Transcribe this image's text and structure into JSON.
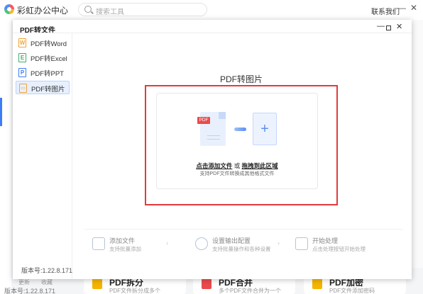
{
  "app": {
    "name": "彩虹办公中心",
    "search_placeholder": "搜索工具",
    "contact": "联系我们",
    "minimize": "—",
    "close": "✕",
    "version": "版本号:1.22.8.171",
    "update": "更新",
    "collect": "收藏"
  },
  "bg_cards": [
    {
      "title": "PDF拆分",
      "sub": "PDF文件拆分成多个"
    },
    {
      "title": "PDF合并",
      "sub": "多个PDF文件合并为一个"
    },
    {
      "title": "PDF加密",
      "sub": "PDF文件添加密码"
    }
  ],
  "dialog": {
    "title": "PDF转文件",
    "minimize": "—",
    "close": "✕",
    "version": "版本号:1.22.8.171",
    "nav": [
      {
        "label": "PDF转Word",
        "icon": "word-icon",
        "glyph": "W",
        "color": "#f0a43a"
      },
      {
        "label": "PDF转Excel",
        "icon": "excel-icon",
        "glyph": "E",
        "color": "#3fae6a"
      },
      {
        "label": "PDF转PPT",
        "icon": "ppt-icon",
        "glyph": "P",
        "color": "#3d7cf5"
      },
      {
        "label": "PDF转图片",
        "icon": "image-icon",
        "glyph": "▭",
        "color": "#f0a43a"
      }
    ],
    "active_nav_index": 3,
    "main_title": "PDF转图片",
    "drop": {
      "pdf_tag": "PDF",
      "plus": "+",
      "click_add": "点击添加文件",
      "or": " 或 ",
      "drag_here": "拖拽到此区域",
      "support": "支持PDF文件转换成其他格式文件"
    },
    "steps": [
      {
        "title": "添加文件",
        "sub": "支持批量添加"
      },
      {
        "title": "设置输出配置",
        "sub": "支持批量操作和各种设置"
      },
      {
        "title": "开始处理",
        "sub": "点击处理按钮开始处理"
      }
    ],
    "step_arrow": "›"
  },
  "colors": {
    "accent": "#3d7cf5",
    "highlight_box": "#e03b3b",
    "pdf_red": "#ea4b4b"
  }
}
